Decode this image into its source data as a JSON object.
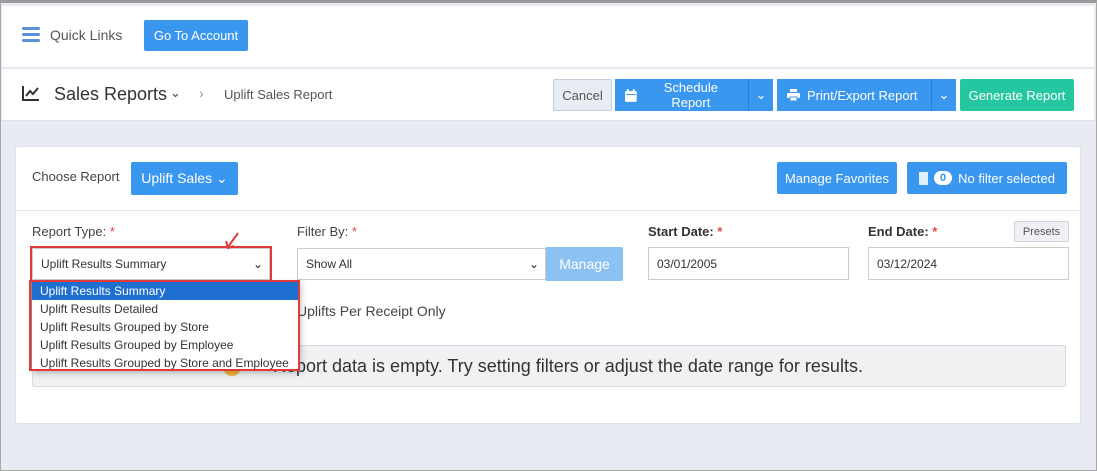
{
  "topbar": {
    "quick_links": "Quick Links",
    "go_to_account": "Go To Account"
  },
  "header": {
    "title": "Sales Reports",
    "breadcrumb": "Uplift Sales Report",
    "cancel": "Cancel",
    "schedule_report": "Schedule Report",
    "print_export": "Print/Export Report",
    "generate_report": "Generate Report"
  },
  "card": {
    "choose_report_label": "Choose Report",
    "selected_report": "Uplift Sales",
    "manage_favorites": "Manage Favorites",
    "filter_count": "0",
    "no_filter": "No filter selected",
    "report_type_label": "Report Type:",
    "filter_by_label": "Filter By:",
    "start_date_label": "Start Date:",
    "end_date_label": "End Date:",
    "required_mark": "*",
    "presets": "Presets",
    "report_type_value": "Uplift Results Summary",
    "filter_by_value": "Show All",
    "manage": "Manage",
    "start_date": "03/01/2005",
    "end_date": "03/12/2024",
    "checkbox_text": "Uplifts Per Receipt Only",
    "alert_text": "Report data is empty. Try setting filters or adjust the date range for results."
  },
  "dropdown": {
    "options": [
      "Uplift Results Summary",
      "Uplift Results Detailed",
      "Uplift Results Grouped by Store",
      "Uplift Results Grouped by Employee",
      "Uplift Results Grouped by Store and Employee"
    ],
    "selected_index": 0
  },
  "colors": {
    "primary": "#3a97f0",
    "success": "#24c7a0",
    "highlight": "#e03a3a",
    "selected": "#1f6fd1"
  }
}
